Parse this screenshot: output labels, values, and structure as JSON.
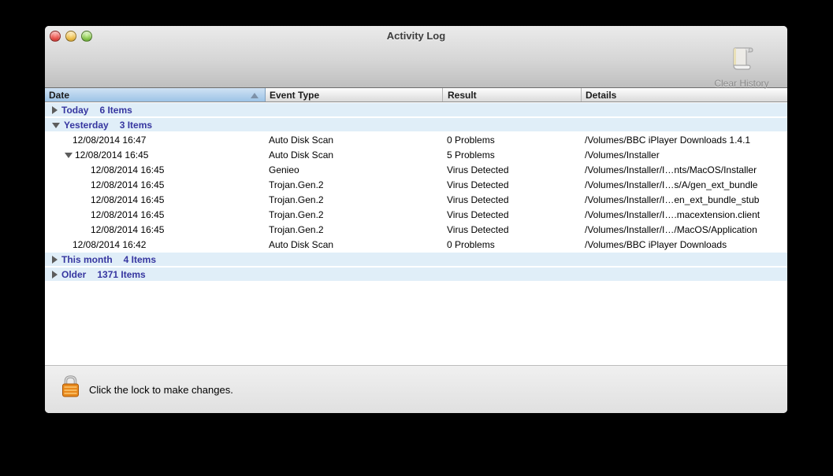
{
  "window": {
    "title": "Activity Log"
  },
  "toolbar": {
    "clear_history_label": "Clear History"
  },
  "table": {
    "columns": [
      {
        "label": "Date",
        "sorted": true
      },
      {
        "label": "Event Type"
      },
      {
        "label": "Result"
      },
      {
        "label": "Details"
      }
    ],
    "rows": [
      {
        "type": "group",
        "state": "collapsed",
        "label": "Today",
        "count": "6 Items"
      },
      {
        "type": "group",
        "state": "expanded",
        "label": "Yesterday",
        "count": "3 Items"
      },
      {
        "type": "data",
        "level": 1,
        "expandable": false,
        "date": "12/08/2014 16:47",
        "event": "Auto Disk Scan",
        "result": "0 Problems",
        "details": "/Volumes/BBC iPlayer Downloads 1.4.1"
      },
      {
        "type": "data",
        "level": 1,
        "expandable": true,
        "date": "12/08/2014 16:45",
        "event": "Auto Disk Scan",
        "result": "5 Problems",
        "details": "/Volumes/Installer"
      },
      {
        "type": "data",
        "level": 2,
        "expandable": false,
        "date": "12/08/2014 16:45",
        "event": "Genieo",
        "result": "Virus Detected",
        "details": "/Volumes/Installer/I…nts/MacOS/Installer"
      },
      {
        "type": "data",
        "level": 2,
        "expandable": false,
        "date": "12/08/2014 16:45",
        "event": "Trojan.Gen.2",
        "result": "Virus Detected",
        "details": "/Volumes/Installer/I…s/A/gen_ext_bundle"
      },
      {
        "type": "data",
        "level": 2,
        "expandable": false,
        "date": "12/08/2014 16:45",
        "event": "Trojan.Gen.2",
        "result": "Virus Detected",
        "details": "/Volumes/Installer/I…en_ext_bundle_stub"
      },
      {
        "type": "data",
        "level": 2,
        "expandable": false,
        "date": "12/08/2014 16:45",
        "event": "Trojan.Gen.2",
        "result": "Virus Detected",
        "details": "/Volumes/Installer/I….macextension.client"
      },
      {
        "type": "data",
        "level": 2,
        "expandable": false,
        "date": "12/08/2014 16:45",
        "event": "Trojan.Gen.2",
        "result": "Virus Detected",
        "details": "/Volumes/Installer/I…/MacOS/Application"
      },
      {
        "type": "data",
        "level": 1,
        "expandable": false,
        "date": "12/08/2014 16:42",
        "event": "Auto Disk Scan",
        "result": "0 Problems",
        "details": "/Volumes/BBC iPlayer Downloads"
      },
      {
        "type": "group",
        "state": "collapsed",
        "label": "This month",
        "count": "4 Items"
      },
      {
        "type": "group",
        "state": "collapsed",
        "label": "Older",
        "count": "1371 Items"
      }
    ]
  },
  "footer": {
    "lock_message": "Click the lock to make changes."
  },
  "colors": {
    "group_row_bg": "#e0eef8",
    "group_text": "#3636a0",
    "sorted_header_top": "#cfe2f4",
    "sorted_header_bottom": "#9cc3e6",
    "lock_body": "#e8891d",
    "traffic_red": "#e0443e",
    "traffic_yellow": "#e9b63e",
    "traffic_green": "#7fc043"
  }
}
